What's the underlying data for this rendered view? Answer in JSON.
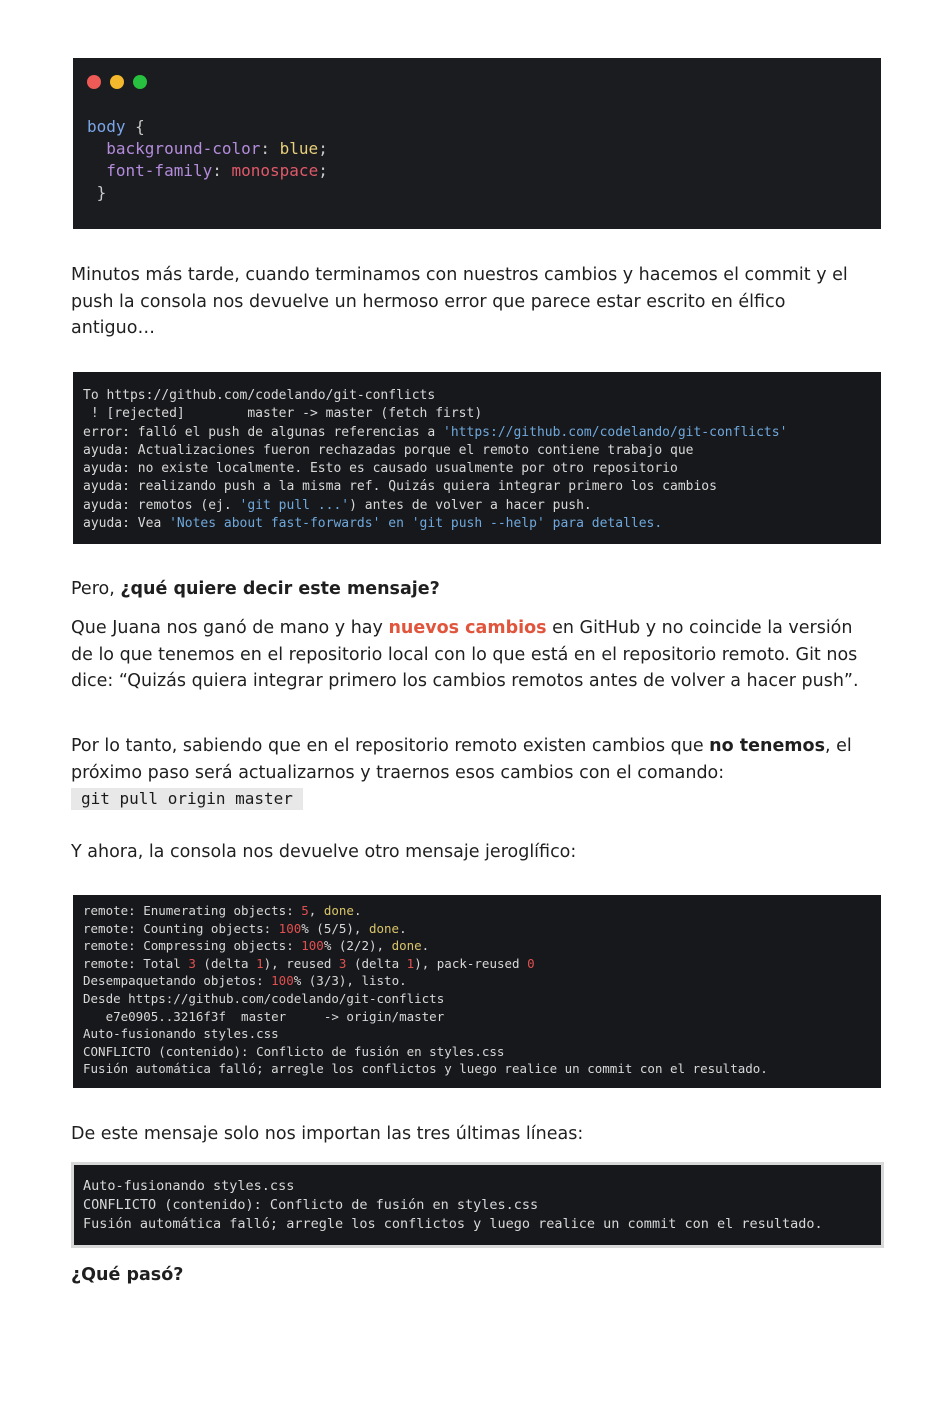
{
  "colors": {
    "dot_red": "#ee5b56",
    "dot_yellow": "#f4b82c",
    "dot_green": "#27c13f",
    "accent_orange": "#e0553c",
    "terminal_bg": "#17181b"
  },
  "code_window": {
    "selector": "body",
    "open_brace": " {",
    "prop1": "background-color",
    "val1": "blue",
    "prop2": "font-family",
    "val2": "monospace",
    "close_brace": "}"
  },
  "para1": "Minutos más tarde, cuando terminamos con nuestros cambios y hacemos el commit y el push la consola nos devuelve un hermoso error que parece estar escrito en élfico antiguo…",
  "terminal1": {
    "l1": "To https://github.com/codelando/git-conflicts",
    "l2": " ! [rejected]        master -> master (fetch first)",
    "l3_a": "error: falló el push de algunas referencias a ",
    "l3_b": "'https://github.com/codelando/git-conflicts'",
    "l4": "ayuda: Actualizaciones fueron rechazadas porque el remoto contiene trabajo que",
    "l5": "ayuda: no existe localmente. Esto es causado usualmente por otro repositorio",
    "l6": "ayuda: realizando push a la misma ref. Quizás quiera integrar primero los cambios",
    "l7_a": "ayuda: remotos (ej. ",
    "l7_b": "'git pull ...'",
    "l7_c": ") antes de volver a hacer push.",
    "l8_a": "ayuda: Vea ",
    "l8_b": "'Notes about fast-forwards'",
    "l8_c": " en ",
    "l8_d": "'git push --help'",
    "l8_e": " para detalles."
  },
  "para2": {
    "prefix": "Pero, ",
    "bold": "¿qué quiere decir este mensaje?"
  },
  "para3": {
    "a": "Que Juana nos ganó de mano y hay ",
    "highlight": "nuevos cambios",
    "b": " en GitHub y no coincide la versión de lo que tenemos en el repositorio local con lo que está en el repositorio remoto. Git nos dice: “Quizás quiera integrar primero los cambios remotos antes de volver a hacer push”."
  },
  "para4": {
    "a": "Por lo tanto, sabiendo que en el repositorio remoto existen cambios que ",
    "bold": "no tenemos",
    "b": ", el próximo paso será actualizarnos y traernos esos cambios con el comando:",
    "code": "git pull origin master"
  },
  "para5": "Y ahora, la consola nos devuelve otro mensaje jeroglífico:",
  "terminal2": {
    "l1_a": "remote: Enumerating objects: ",
    "l1_n": "5",
    "l1_b": ", ",
    "l1_done": "done",
    "l1_c": ".",
    "l2_a": "remote: Counting objects: ",
    "l2_n": "100",
    "l2_b": "% (5/5), ",
    "l2_done": "done",
    "l2_c": ".",
    "l3_a": "remote: Compressing objects: ",
    "l3_n": "100",
    "l3_b": "% (2/2), ",
    "l3_done": "done",
    "l3_c": ".",
    "l4_a": "remote: Total ",
    "l4_n1": "3",
    "l4_b": " (delta ",
    "l4_n2": "1",
    "l4_c": "), reused ",
    "l4_n3": "3",
    "l4_d": " (delta ",
    "l4_n4": "1",
    "l4_e": "), pack-reused ",
    "l4_n5": "0",
    "l5_a": "Desempaquetando objetos: ",
    "l5_n": "100",
    "l5_b": "% (3/3), listo.",
    "l6": "Desde https://github.com/codelando/git-conflicts",
    "l7": "   e7e0905..3216f3f  master     -> origin/master",
    "l8": "Auto-fusionando styles.css",
    "l9": "CONFLICTO (contenido): Conflicto de fusión en styles.css",
    "l10": "Fusión automática falló; arregle los conflictos y luego realice un commit con el resultado."
  },
  "para6": "De este mensaje solo nos importan las tres últimas líneas:",
  "terminal3": {
    "l1": "Auto-fusionando styles.css",
    "l2": "CONFLICTO (contenido): Conflicto de fusión en styles.css",
    "l3": "Fusión automática falló; arregle los conflictos y luego realice un commit con el resultado."
  },
  "heading_final": "¿Qué pasó?"
}
